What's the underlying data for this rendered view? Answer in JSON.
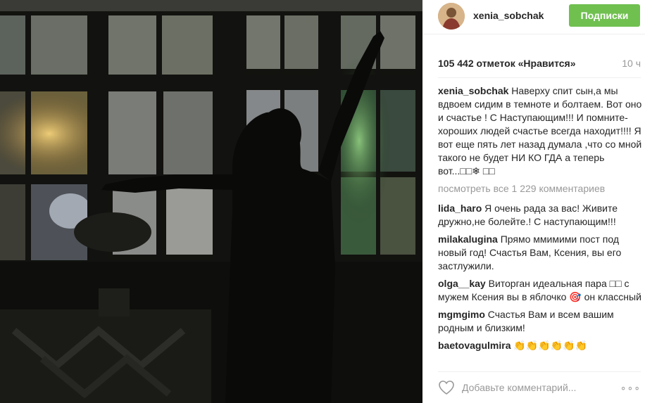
{
  "post": {
    "username": "xenia_sobchak",
    "follow_label": "Подписки",
    "likes": "105 442 отметок «Нравится»",
    "time": "10 ч",
    "caption": {
      "user": "xenia_sobchak",
      "text": "Наверху спит сын,а мы вдвоем сидим в темноте и болтаем. Вот оно и счастье ! С Наступающим!!! И помните-хороших людей счастье всегда находит!!!! Я вот еще пять лет назад думала ,что со мной такого не будет НИ КО ГДА а теперь вот...□□❄ □□"
    },
    "view_all": "посмотреть все 1 229 комментариев",
    "comments": [
      {
        "user": "lida_haro",
        "text": "Я очень рада за вас! Живите дружно,не болейте.! С наступающим!!!"
      },
      {
        "user": "milakalugina",
        "text": "Прямо ммимими пост под новый год! Счастья Вам, Ксения, вы его застлужили."
      },
      {
        "user": "olga__kay",
        "text": "Виторган идеальная пара □□ с мужем Ксения вы в яблочко 🎯 он классный"
      },
      {
        "user": "mgmgimo",
        "text": "Счастья Вам и всем вашим родным и близким!"
      },
      {
        "user": "baetovagulmira",
        "text": "👏👏👏👏👏👏"
      }
    ],
    "add_comment_placeholder": "Добавьте комментарий...",
    "more": "∘∘∘"
  },
  "icons": {
    "heart": "heart-outline-icon",
    "more": "more-options-icon"
  },
  "colors": {
    "follow": "#70c050",
    "muted": "#999999",
    "text": "#262626"
  }
}
